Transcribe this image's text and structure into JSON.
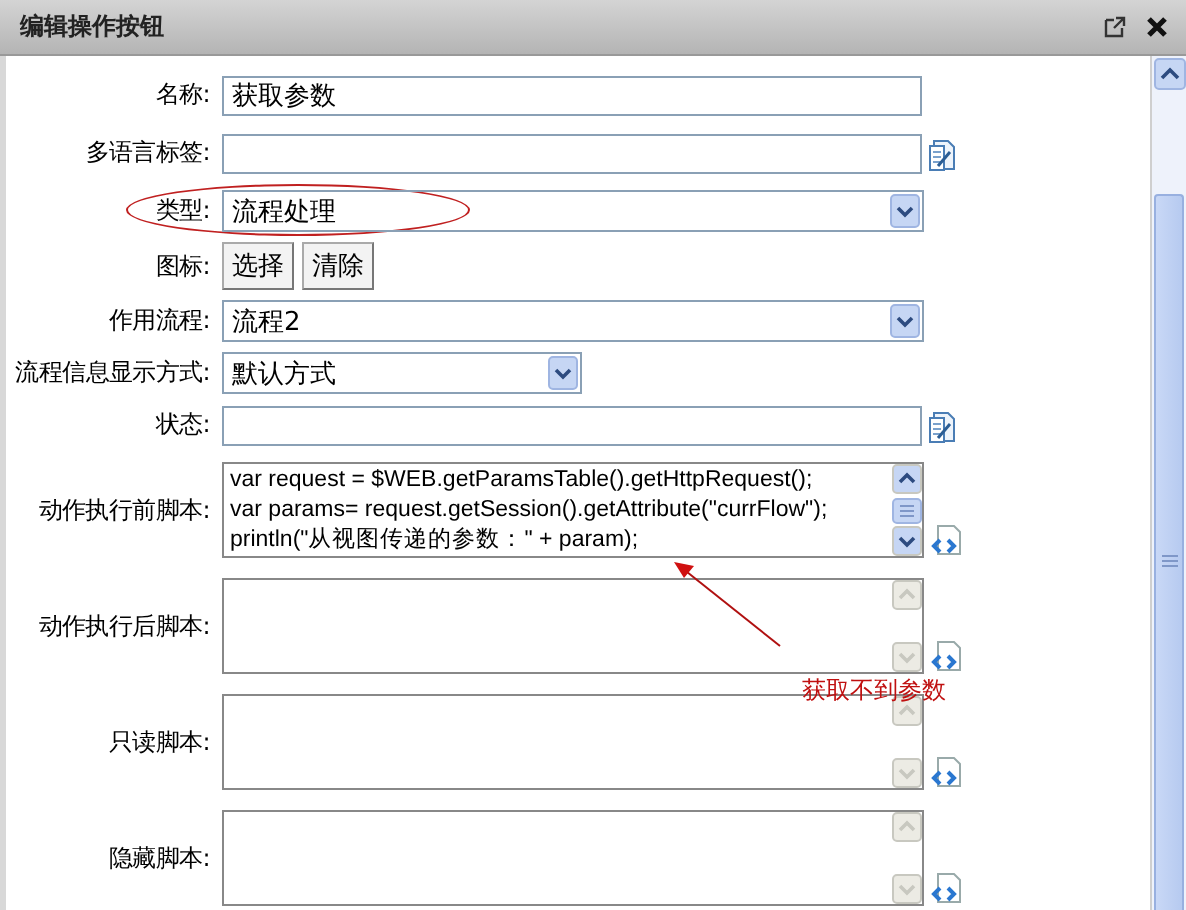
{
  "dialog": {
    "title": "编辑操作按钮",
    "fields": [
      {
        "kind": "text",
        "label": "名称:",
        "value": "获取参数",
        "highlighted": false
      },
      {
        "kind": "annotated",
        "label": "多语言标签:",
        "highlighted": false
      },
      {
        "kind": "select",
        "label": "类型:",
        "value": "流程处理",
        "compact": false,
        "highlighted": true
      },
      {
        "kind": "buttons",
        "label": "图标:",
        "buttons": [
          "选择",
          "清除"
        ],
        "highlighted": false
      },
      {
        "kind": "select",
        "label": "作用流程:",
        "value": "流程2",
        "compact": false,
        "highlighted": false
      },
      {
        "kind": "select",
        "label": "流程信息显示方式:",
        "value": "默认方式",
        "compact": true,
        "highlighted": false
      },
      {
        "kind": "annotated",
        "label": "状态:",
        "highlighted": false
      },
      {
        "kind": "script",
        "label": "动作执行前脚本:",
        "lines": [
          "var request = $WEB.getParamsTable().getHttpRequest();",
          "var params= request.getSession().getAttribute(\"currFlow\");",
          "println(\"从视图传递的参数：\" + param);"
        ],
        "scroll_enabled": true,
        "highlighted": false
      },
      {
        "kind": "script",
        "label": "动作执行后脚本:",
        "scroll_enabled": false,
        "highlighted": false
      },
      {
        "kind": "script",
        "label": "只读脚本:",
        "scroll_enabled": false,
        "highlighted": false
      },
      {
        "kind": "script",
        "label": "隐藏脚本:",
        "scroll_enabled": false,
        "highlighted": false
      }
    ],
    "annotation": {
      "text": "获取不到参数"
    }
  }
}
